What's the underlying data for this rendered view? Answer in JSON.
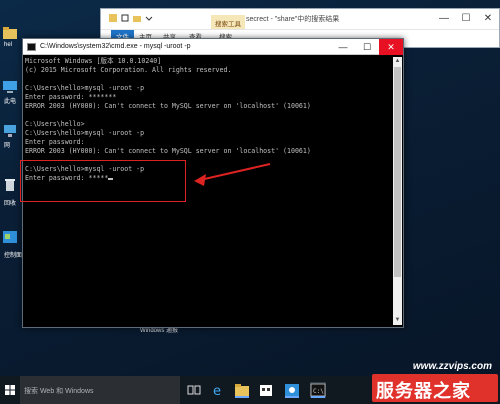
{
  "explorer": {
    "title": "secrect - \"share\"中的搜索结果",
    "search_tools_tab": "搜索工具",
    "ribbon_tabs": [
      "文件",
      "主页",
      "共享",
      "查看",
      "搜索"
    ],
    "controls": {
      "minimize": "—",
      "maximize": "☐",
      "close": "✕"
    }
  },
  "cmd": {
    "title": "C:\\Windows\\system32\\cmd.exe - mysql  -uroot -p",
    "controls": {
      "minimize": "—",
      "maximize": "☐",
      "close": "✕"
    },
    "lines": [
      "Microsoft Windows [版本 10.0.10240]",
      "(c) 2015 Microsoft Corporation. All rights reserved.",
      "",
      "C:\\Users\\hello>mysql -uroot -p",
      "Enter password: *******",
      "ERROR 2003 (HY000): Can't connect to MySQL server on 'localhost' (10061)",
      "",
      "C:\\Users\\hello>",
      "C:\\Users\\hello>mysql -uroot -p",
      "Enter password:",
      "ERROR 2003 (HY000): Can't connect to MySQL server on 'localhost' (10061)",
      "",
      "C:\\Users\\hello>mysql -uroot -p",
      "Enter password: *****"
    ]
  },
  "desktop": {
    "icons": [
      {
        "label": "hel",
        "icon": "user-folder-icon"
      },
      {
        "label": "此电",
        "icon": "this-pc-icon"
      },
      {
        "label": "网",
        "icon": "network-icon"
      },
      {
        "label": "回收",
        "icon": "recycle-bin-icon"
      },
      {
        "label": "控制面",
        "icon": "control-panel-icon"
      }
    ],
    "status_text": "Windows 通报"
  },
  "taskbar": {
    "search_placeholder": "搜索 Web 和 Windows",
    "icons": [
      "task-view-icon",
      "edge-icon",
      "file-explorer-icon",
      "store-icon",
      "control-panel-icon",
      "cmd-icon"
    ]
  },
  "watermark": {
    "url": "www.zzvips.com",
    "brand": "服务器之家"
  },
  "colors": {
    "accent": "#1e73c8",
    "close_red": "#e81123",
    "annotation": "#dd2222",
    "brand_red": "#e0312b"
  }
}
